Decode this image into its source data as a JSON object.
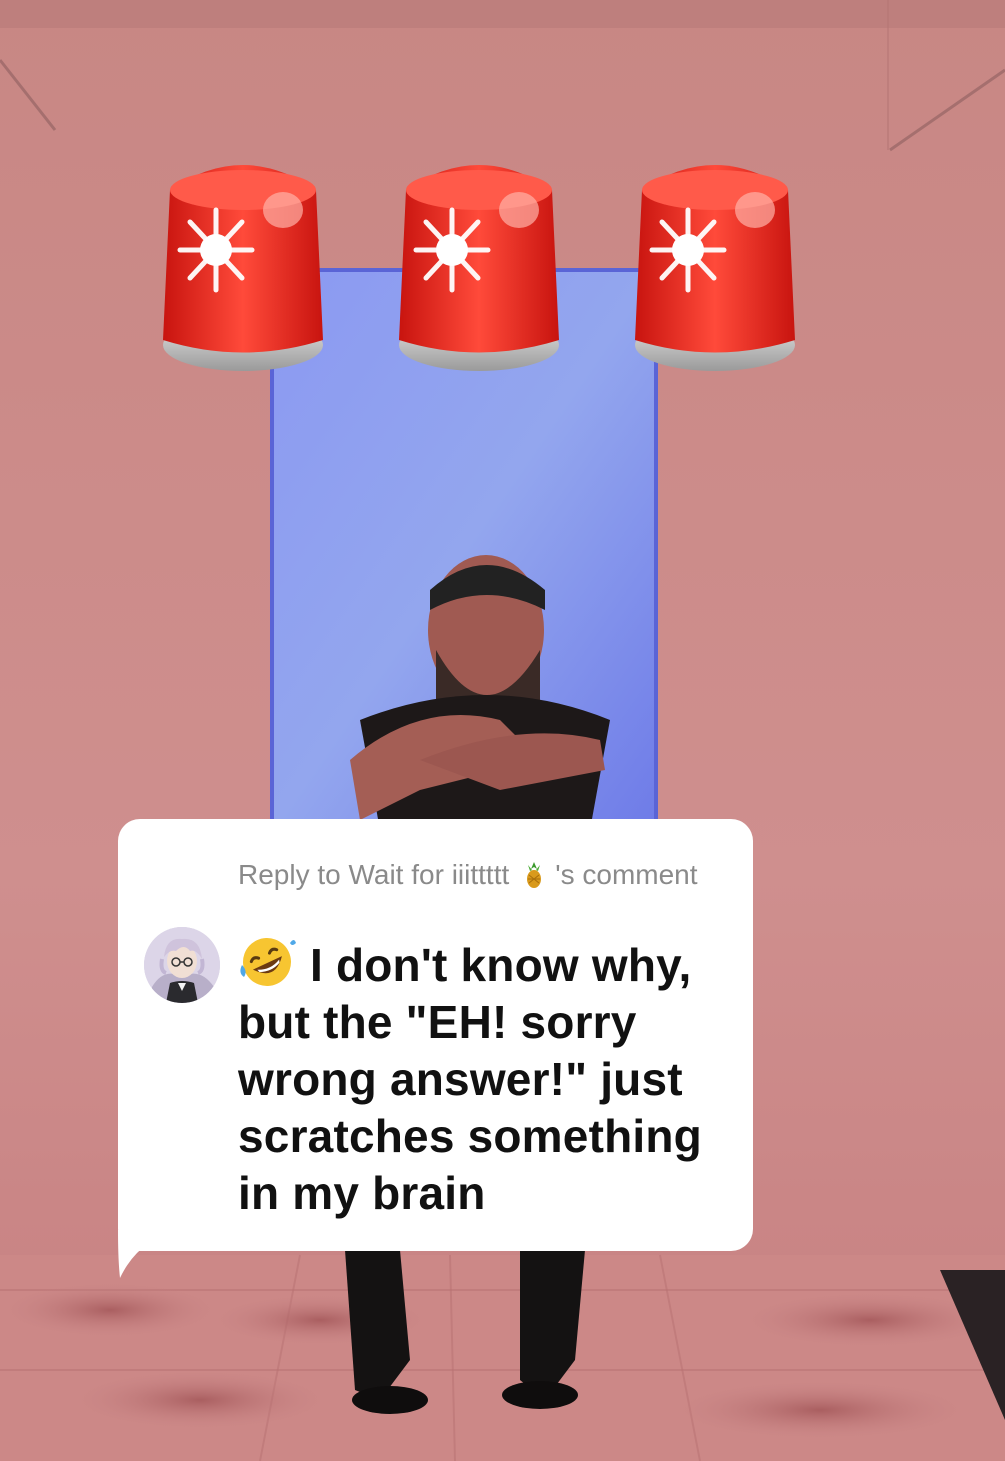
{
  "reply": {
    "prefix": "Reply to Wait for iiittttt",
    "suffix": "'s comment",
    "comment_text": "I don't know why, but the \"EH! sorry wrong answer!\" just scratches something in my brain"
  },
  "icons": {
    "sirens": [
      "rotating-light-icon",
      "rotating-light-icon",
      "rotating-light-icon"
    ],
    "header_emoji": "pineapple-icon",
    "comment_emoji": "rolling-on-floor-laughing-icon"
  },
  "colors": {
    "background": "#c98b8b",
    "door": "#7f8ff0",
    "siren_red": "#e8261c",
    "card": "#ffffff",
    "header_text": "#8a8a8a",
    "body_text": "#111111"
  }
}
